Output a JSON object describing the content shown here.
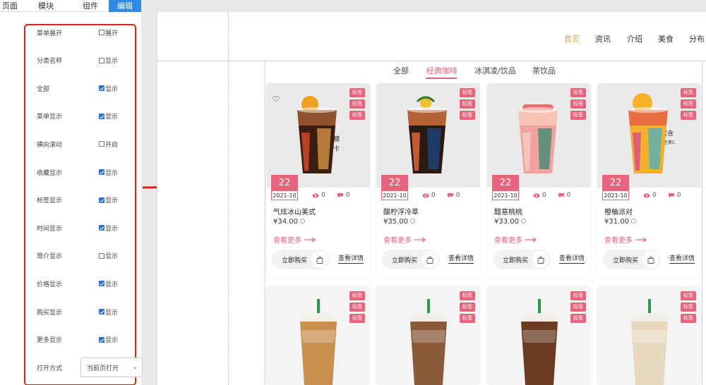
{
  "top_tabs": [
    {
      "label": "页面"
    },
    {
      "label": "模块"
    },
    {
      "label": "组件"
    },
    {
      "label": "编辑"
    }
  ],
  "settings": {
    "rows": [
      {
        "label": "菜单展开",
        "check_label": "展开",
        "checked": false
      },
      {
        "label": "分类名称",
        "check_label": "显示",
        "checked": false
      },
      {
        "label": "全部",
        "check_label": "显示",
        "checked": true
      },
      {
        "label": "菜单显示",
        "check_label": "显示",
        "checked": true
      },
      {
        "label": "横向滚动",
        "check_label": "开启",
        "checked": false
      },
      {
        "label": "收藏显示",
        "check_label": "显示",
        "checked": true
      },
      {
        "label": "标签显示",
        "check_label": "显示",
        "checked": true
      },
      {
        "label": "时间显示",
        "check_label": "显示",
        "checked": true
      },
      {
        "label": "简介显示",
        "check_label": "显示",
        "checked": false
      },
      {
        "label": "价格显示",
        "check_label": "显示",
        "checked": true
      },
      {
        "label": "购买显示",
        "check_label": "显示",
        "checked": true
      },
      {
        "label": "更多显示",
        "check_label": "显示",
        "checked": true
      }
    ],
    "open_mode_label": "打开方式",
    "open_mode_value": "当前页打开"
  },
  "nav": {
    "items": [
      "首页",
      "资讯",
      "介绍",
      "美食",
      "分布"
    ]
  },
  "categories": {
    "items": [
      "全部",
      "经典咖啡",
      "冰淇凌/饮品",
      "茶饮品"
    ]
  },
  "cards": [
    {
      "day": "22",
      "ym": "2021-10",
      "views": "0",
      "comments": "0",
      "title": "气炫冰山美式",
      "price": "¥34.00",
      "more": "查看更多",
      "buy": "立即购买",
      "detail": "查看详情",
      "tags": [
        "标签",
        "标签",
        "标签"
      ]
    },
    {
      "day": "22",
      "ym": "2021-10",
      "views": "0",
      "comments": "0",
      "title": "酸柠浮冷萃",
      "price": "¥35.00",
      "more": "查看更多",
      "buy": "立即购买",
      "detail": "查看详情",
      "tags": [
        "标签",
        "标签",
        "标签"
      ]
    },
    {
      "day": "22",
      "ym": "2021-10",
      "views": "0",
      "comments": "0",
      "title": "醋意桃桃",
      "price": "¥33.00",
      "more": "查看更多",
      "buy": "立即购买",
      "detail": "查看详情",
      "tags": [
        "标签",
        "标签",
        "标签"
      ]
    },
    {
      "day": "22",
      "ym": "2021-10",
      "views": "0",
      "comments": "0",
      "title": "橙柚派对",
      "price": "¥31.00",
      "more": "查看更多",
      "buy": "立即购买",
      "detail": "查看详情",
      "tags": [
        "标签",
        "标签",
        "标签"
      ]
    }
  ],
  "cards_row2": [
    {
      "tags": [
        "标签",
        "标签",
        "标签"
      ]
    },
    {
      "tags": [
        "标签",
        "标签",
        "标签"
      ]
    },
    {
      "tags": [
        "标签",
        "标签",
        "标签"
      ]
    },
    {
      "tags": [
        "标签",
        "标签",
        "标签"
      ]
    }
  ],
  "drink_labels": {
    "card1": "低糖 低卡",
    "card4": "富含 维生素C"
  },
  "colors": {
    "accent_blue": "#2f8ae5",
    "highlight_red": "#d9261c",
    "tag_pink": "#e8637b",
    "nav_active": "#e8a24a"
  }
}
